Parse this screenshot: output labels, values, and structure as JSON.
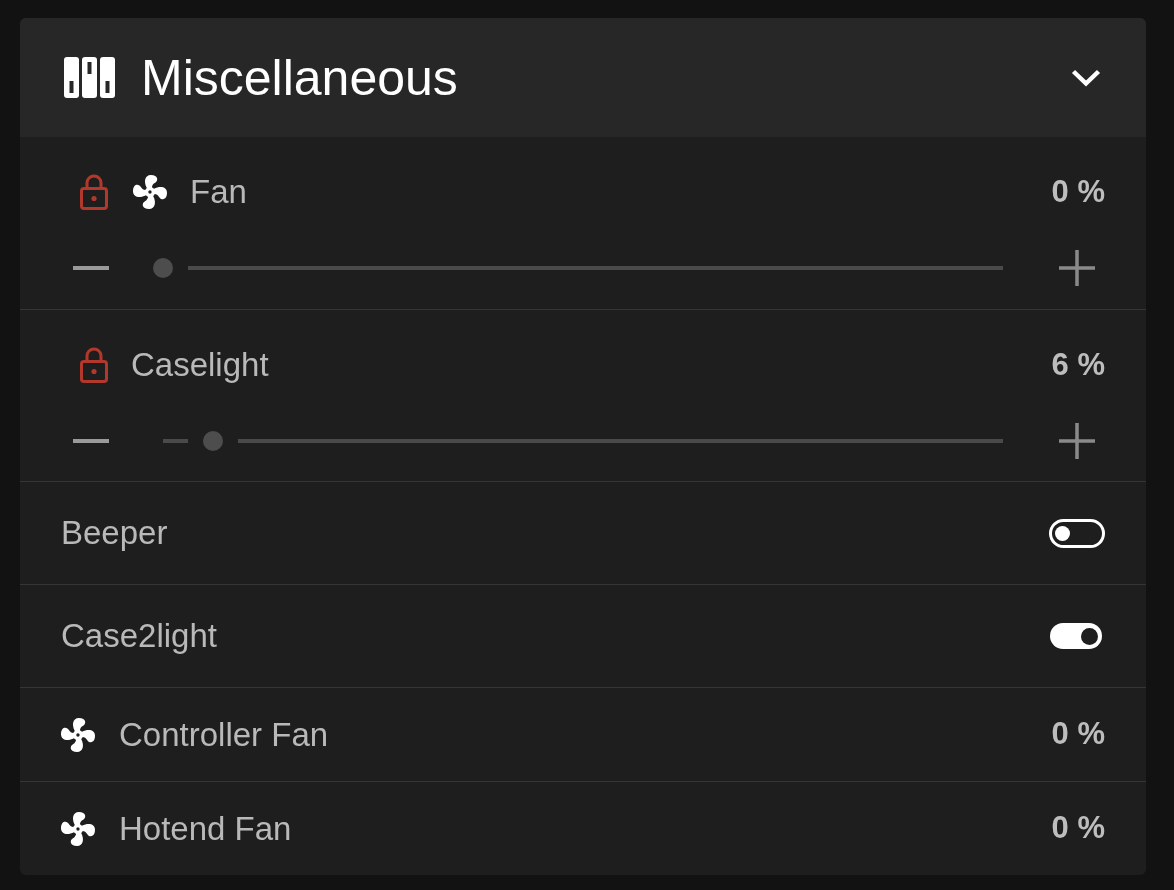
{
  "panel": {
    "title": "Miscellaneous",
    "expanded": true
  },
  "items": [
    {
      "kind": "slider",
      "label": "Fan",
      "locked": true,
      "fan": true,
      "value": "0 %",
      "level": 0
    },
    {
      "kind": "slider",
      "label": "Caselight",
      "locked": true,
      "fan": false,
      "value": "6 %",
      "level": 0.06
    },
    {
      "kind": "toggle",
      "label": "Beeper",
      "on": false
    },
    {
      "kind": "toggle",
      "label": "Case2light",
      "on": true
    },
    {
      "kind": "readout",
      "label": "Controller Fan",
      "fan": true,
      "value": "0 %"
    },
    {
      "kind": "readout",
      "label": "Hotend Fan",
      "fan": true,
      "value": "0 %"
    }
  ]
}
